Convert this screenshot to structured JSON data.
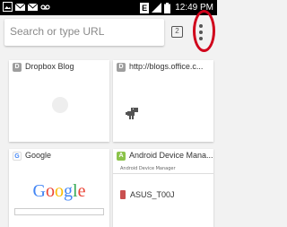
{
  "status_bar": {
    "time": "12:49 PM",
    "left_icons": [
      "gallery-icon",
      "mail-icon",
      "mail-icon",
      "voicemail-icon"
    ],
    "right_icons": [
      "data-icon",
      "signal-icon",
      "battery-icon"
    ],
    "data_badge": "E"
  },
  "toolbar": {
    "omnibox_placeholder": "Search or type URL",
    "tab_count": "2"
  },
  "tiles": [
    {
      "favicon": "D",
      "title": "Dropbox Blog"
    },
    {
      "favicon": "D",
      "title": "http://blogs.office.c..."
    },
    {
      "favicon": "G",
      "title": "Google",
      "logo": "Google"
    },
    {
      "favicon": "A",
      "title": "Android Device Mana...",
      "page_header": "Android Device Manager",
      "device_name": "ASUS_T00J"
    }
  ],
  "colors": {
    "highlight_ring": "#d0021b",
    "background": "#f2f2f2"
  }
}
